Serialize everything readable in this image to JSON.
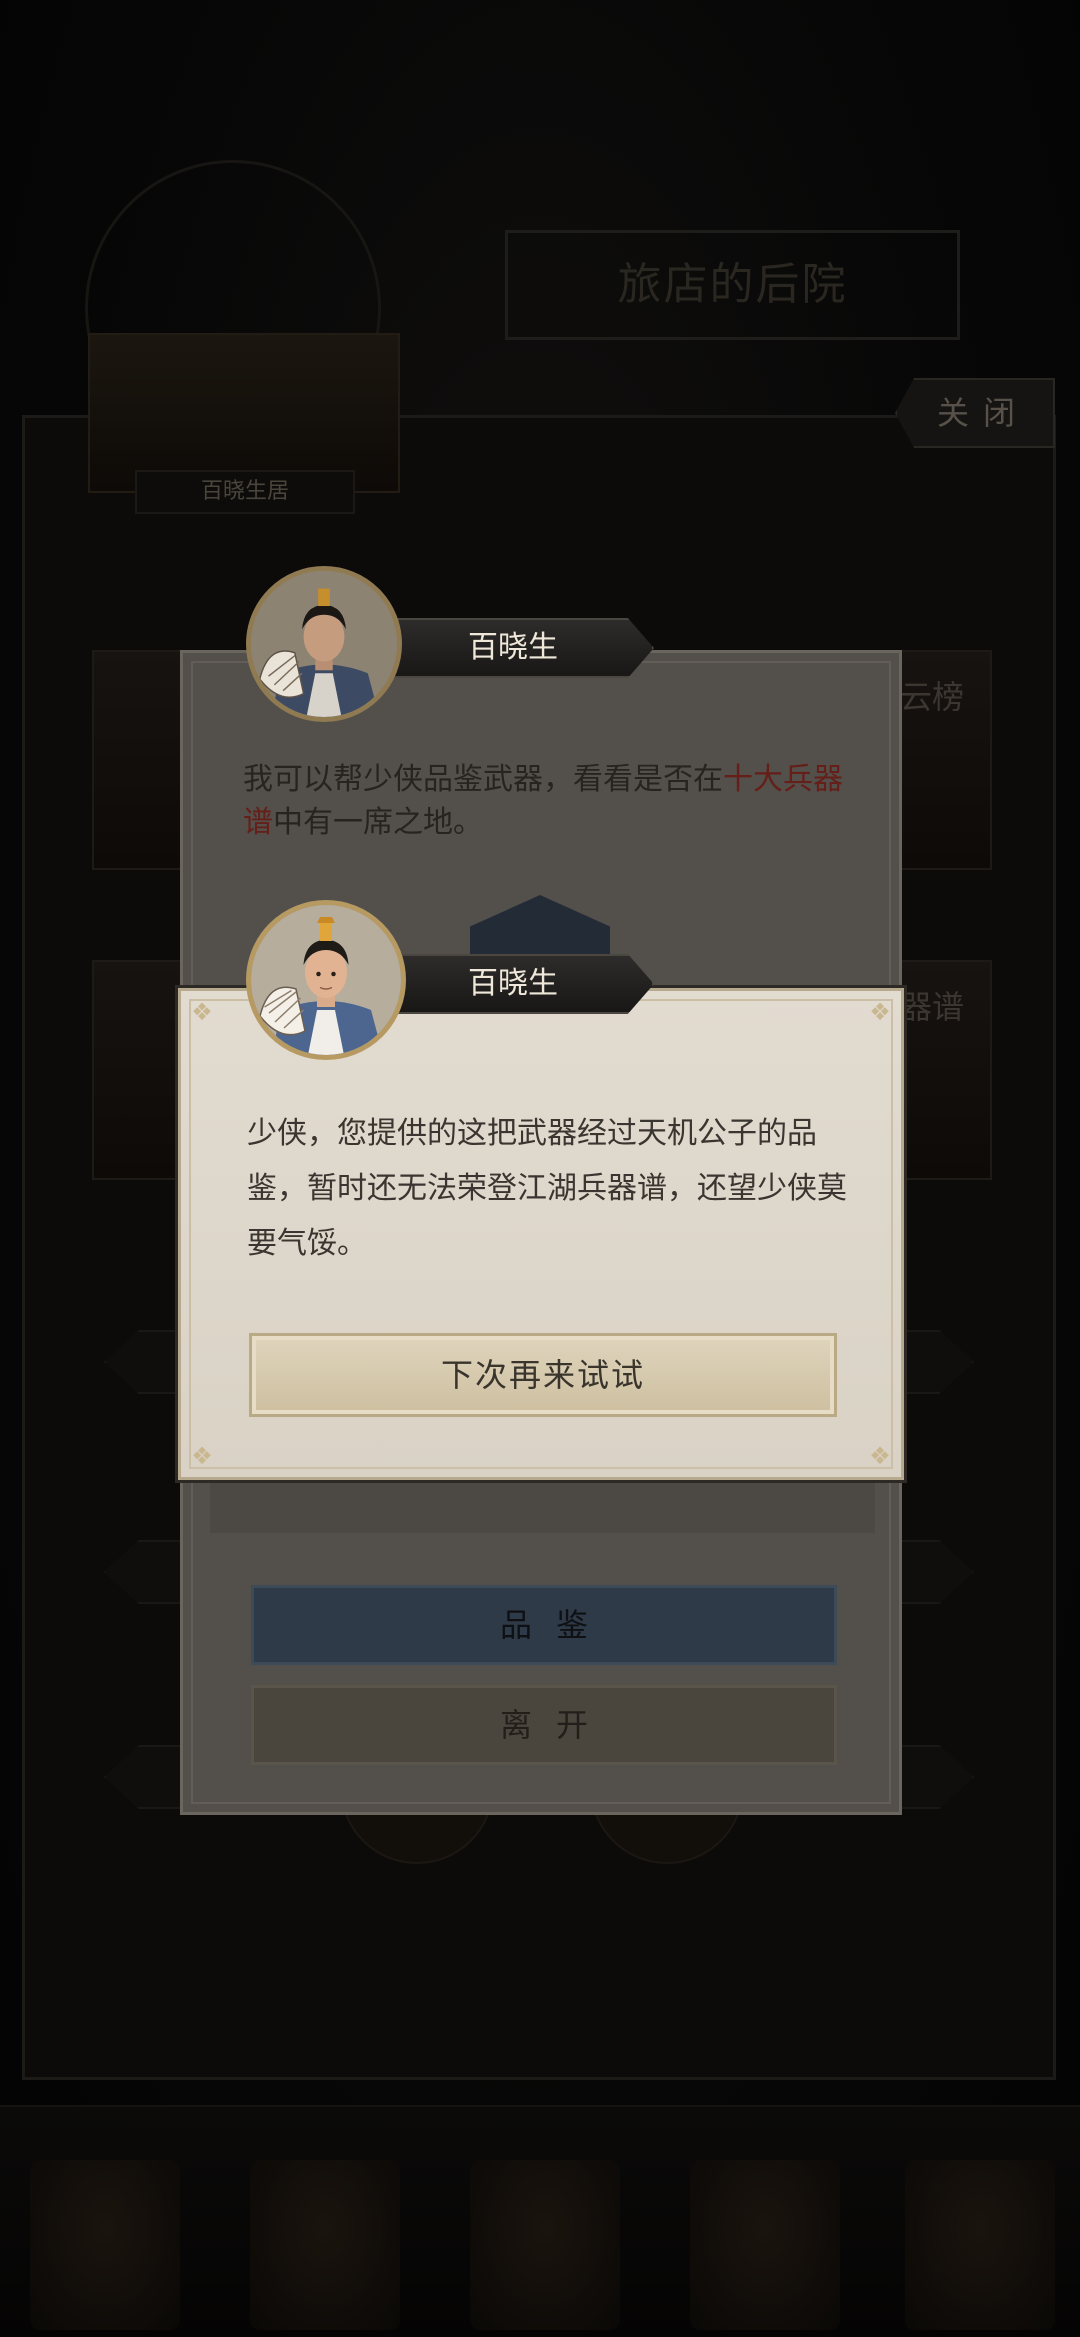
{
  "background": {
    "title": "旅店的后院",
    "location_label": "百晓生居",
    "close_label": "关闭",
    "side_labels": [
      "云榜",
      "器谱"
    ]
  },
  "dialog_back": {
    "speaker": "百晓生",
    "text_before": "我可以帮少侠品鉴武器，看看是否在",
    "text_highlight": "十大兵器谱",
    "text_after": "中有一席之地。",
    "appraise_label": "品鉴",
    "leave_label": "离开"
  },
  "dialog_front": {
    "speaker": "百晓生",
    "message": "少侠，您提供的这把武器经过天机公子的品鉴，暂时还无法荣登江湖兵器谱，还望少侠莫要气馁。",
    "button_label": "下次再来试试"
  },
  "colors": {
    "highlight_red": "#b8362b",
    "dialog_bg": "#e2dbd0",
    "frame_gold": "#b7a98d"
  }
}
